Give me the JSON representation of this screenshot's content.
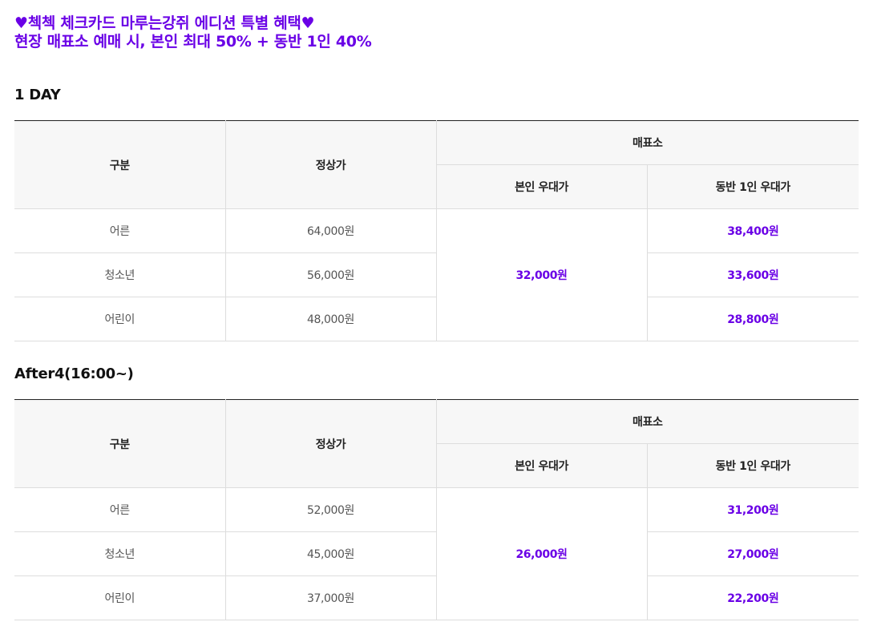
{
  "colors": {
    "accent": "#6a00e6",
    "header_bg": "#f7f7f7",
    "border": "#dddddd",
    "top_border": "#222222"
  },
  "headline": {
    "line1": "♥첵첵 체크카드 마루는강쥐 에디션 특별 혜택♥",
    "line2": "현장 매표소 예매 시, 본인 최대 50% + 동반 1인 40%"
  },
  "table_header": {
    "category": "구분",
    "regular_price": "정상가",
    "box_office": "매표소",
    "self_discount": "본인 우대가",
    "companion_discount": "동반 1인 우대가"
  },
  "sections": [
    {
      "title": "1 DAY",
      "self_price": "32,000원",
      "rows": [
        {
          "category": "어른",
          "regular_price": "64,000원",
          "companion_price": "38,400원"
        },
        {
          "category": "청소년",
          "regular_price": "56,000원",
          "companion_price": "33,600원"
        },
        {
          "category": "어린이",
          "regular_price": "48,000원",
          "companion_price": "28,800원"
        }
      ]
    },
    {
      "title": "After4(16:00~)",
      "self_price": "26,000원",
      "rows": [
        {
          "category": "어른",
          "regular_price": "52,000원",
          "companion_price": "31,200원"
        },
        {
          "category": "청소년",
          "regular_price": "45,000원",
          "companion_price": "27,000원"
        },
        {
          "category": "어린이",
          "regular_price": "37,000원",
          "companion_price": "22,200원"
        }
      ]
    }
  ]
}
